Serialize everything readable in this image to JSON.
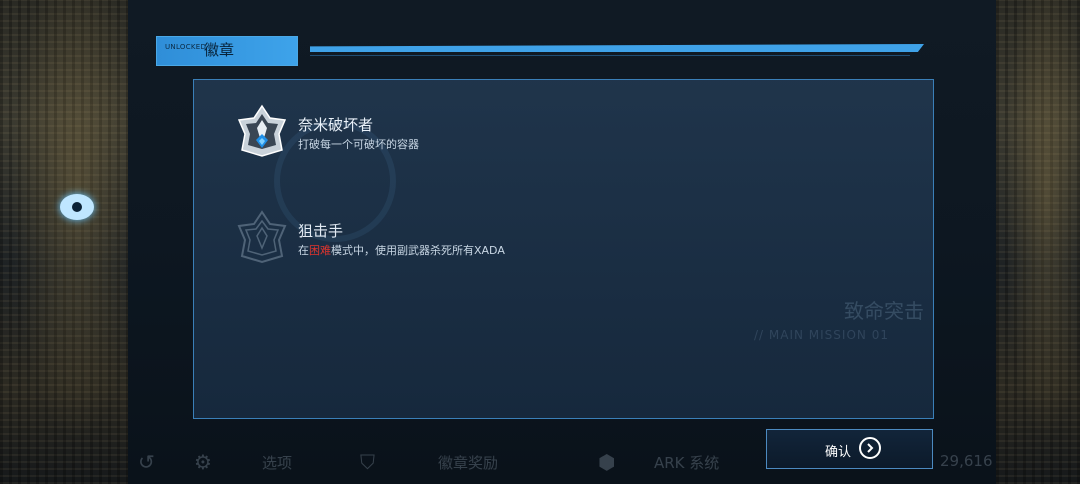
{
  "header": {
    "unlocked_label": "UNLOCKED",
    "title": "徽章"
  },
  "badges": [
    {
      "name": "奈米破坏者",
      "description": "打破每一个可破坏的容器",
      "unlocked": true
    },
    {
      "name": "狙击手",
      "description_prefix": "在",
      "description_highlight": "困难",
      "description_suffix": "模式中，使用副武器杀死所有XADA",
      "unlocked": false
    }
  ],
  "confirm": {
    "label": "确认"
  },
  "background": {
    "mission_title": "致命突击",
    "mission_sub": "// MAIN MISSION 01"
  },
  "bottom_bar": {
    "options_label": "选项",
    "badge_rewards_label": "徽章奖励",
    "ark_label": "ARK 系统",
    "currency": "29,616"
  },
  "colors": {
    "accent": "#3ea3ea",
    "highlight_red": "#e0342e",
    "panel_border": "#3a7fb8"
  },
  "icons": [
    "back-icon",
    "gear-icon",
    "badge-icon",
    "ark-icon",
    "currency-icon",
    "arrow-right-icon"
  ]
}
